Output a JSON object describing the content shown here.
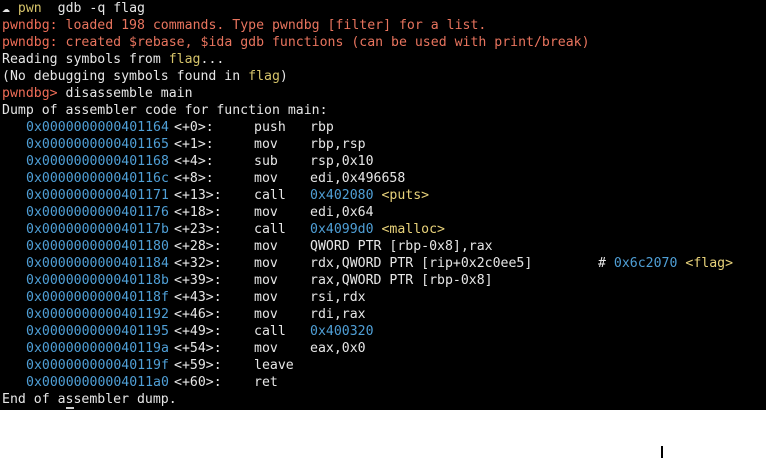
{
  "header": {
    "cloud_glyph": "☁",
    "pwn_label": "pwn",
    "command": "gdb -q flag"
  },
  "banner": {
    "line1_prompt": "pwndbg:",
    "line1_text": "loaded 198 commands. Type pwndbg [filter] for a list.",
    "line2_prompt": "pwndbg:",
    "line2_text": "created $rebase, $ida gdb functions (can be used with print/break)"
  },
  "reading": {
    "prefix": "Reading symbols from ",
    "file": "flag",
    "suffix": "..."
  },
  "no_symbols": {
    "prefix": "(No debugging symbols found in ",
    "file": "flag",
    "suffix": ")"
  },
  "prompt": {
    "label": "pwndbg>",
    "command": "disassemble main"
  },
  "dump_header": "Dump of assembler code for function main:",
  "instructions": [
    {
      "addr": "0x0000000000401164",
      "off": "<+0>:",
      "mn": "push",
      "ops": "rbp"
    },
    {
      "addr": "0x0000000000401165",
      "off": "<+1>:",
      "mn": "mov",
      "ops": "rbp,rsp"
    },
    {
      "addr": "0x0000000000401168",
      "off": "<+4>:",
      "mn": "sub",
      "ops": "rsp,0x10"
    },
    {
      "addr": "0x000000000040116c",
      "off": "<+8>:",
      "mn": "mov",
      "ops": "edi,0x496658"
    },
    {
      "addr": "0x0000000000401171",
      "off": "<+13>:",
      "mn": "call",
      "target": "0x402080",
      "sym": "<puts>"
    },
    {
      "addr": "0x0000000000401176",
      "off": "<+18>:",
      "mn": "mov",
      "ops": "edi,0x64"
    },
    {
      "addr": "0x000000000040117b",
      "off": "<+23>:",
      "mn": "call",
      "target": "0x4099d0",
      "sym": "<malloc>"
    },
    {
      "addr": "0x0000000000401180",
      "off": "<+28>:",
      "mn": "mov",
      "ops": "QWORD PTR [rbp-0x8],rax"
    },
    {
      "addr": "0x0000000000401184",
      "off": "<+32>:",
      "mn": "mov",
      "ops": "rdx,QWORD PTR [rip+0x2c0ee5]",
      "comment_hash": "#",
      "comment_addr": "0x6c2070",
      "comment_sym": "<flag>"
    },
    {
      "addr": "0x000000000040118b",
      "off": "<+39>:",
      "mn": "mov",
      "ops": "rax,QWORD PTR [rbp-0x8]"
    },
    {
      "addr": "0x000000000040118f",
      "off": "<+43>:",
      "mn": "mov",
      "ops": "rsi,rdx"
    },
    {
      "addr": "0x0000000000401192",
      "off": "<+46>:",
      "mn": "mov",
      "ops": "rdi,rax"
    },
    {
      "addr": "0x0000000000401195",
      "off": "<+49>:",
      "mn": "call",
      "target": "0x400320"
    },
    {
      "addr": "0x000000000040119a",
      "off": "<+54>:",
      "mn": "mov",
      "ops": "eax,0x0"
    },
    {
      "addr": "0x000000000040119f",
      "off": "<+59>:",
      "mn": "leave"
    },
    {
      "addr": "0x00000000004011a0",
      "off": "<+60>:",
      "mn": "ret"
    }
  ],
  "dump_footer": "End of assembler dump."
}
